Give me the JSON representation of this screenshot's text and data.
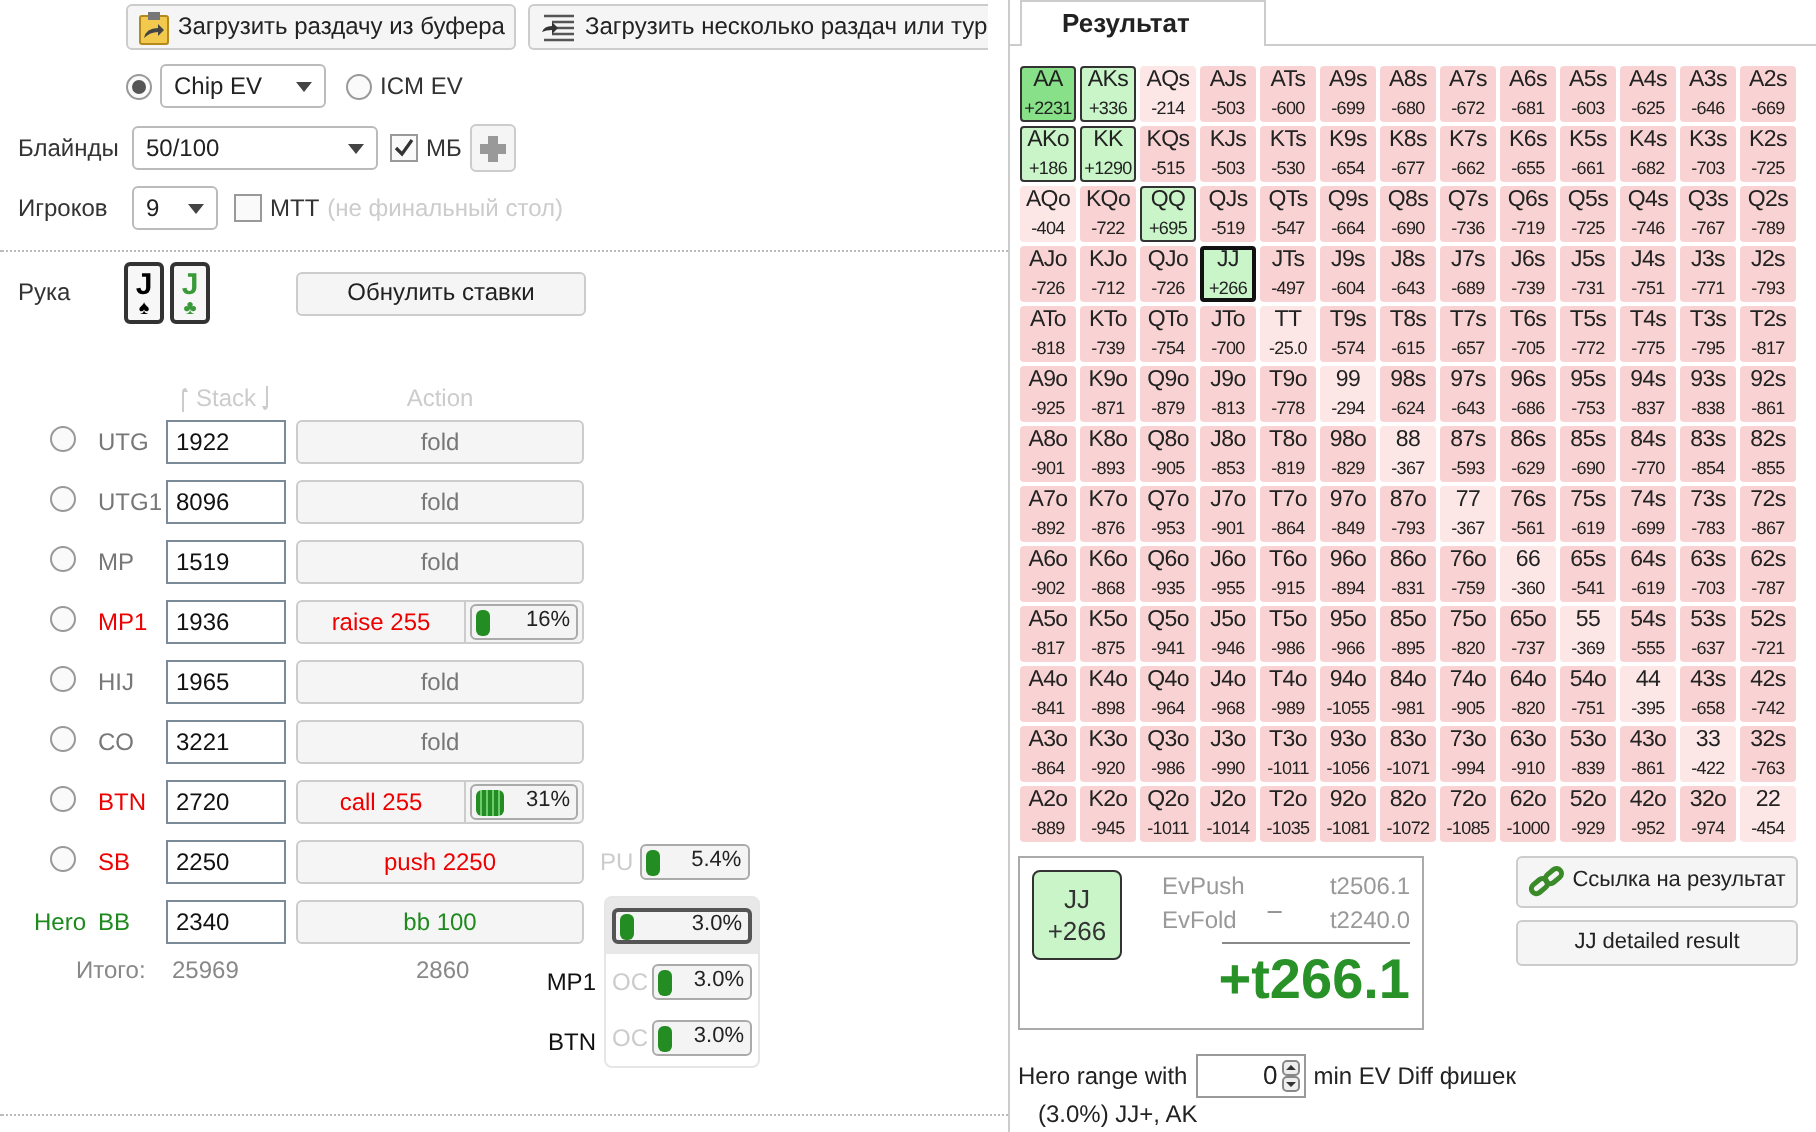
{
  "toolbar": {
    "buttons": [
      {
        "label": "Загрузить раздачу из буфера",
        "kind": "clipboard"
      },
      {
        "label": "Загрузить несколько раздач или тур",
        "kind": "list"
      }
    ]
  },
  "ev_modes": [
    {
      "kind": "select",
      "value": "Chip EV",
      "selected": true
    },
    {
      "kind": "label",
      "label": "ICM EV",
      "selected": false
    }
  ],
  "blinds": {
    "label": "Блайнды",
    "value": "50/100",
    "checkbox": {
      "label": "МБ",
      "checked": true
    }
  },
  "players": {
    "label": "Игроков",
    "value": "9",
    "checkbox": {
      "label": "MTT",
      "checked": false
    },
    "note": "(не финальный стол)"
  },
  "hand": {
    "label": "Рука",
    "cards": [
      {
        "rank": "J",
        "suit": "♠",
        "color": "#000000"
      },
      {
        "rank": "J",
        "suit": "♣",
        "color": "#3a9a3a"
      }
    ],
    "reset_button": "Обнулить ставки"
  },
  "seats": {
    "columns": [
      "Stack",
      "Action"
    ],
    "rows": [
      {
        "position": "UTG",
        "stack": "1922",
        "action": "fold",
        "kind": "fold",
        "selected": false
      },
      {
        "position": "UTG1",
        "stack": "8096",
        "action": "fold",
        "kind": "fold",
        "selected": false
      },
      {
        "position": "MP",
        "stack": "1519",
        "action": "fold",
        "kind": "fold",
        "selected": false
      },
      {
        "position": "MP1",
        "stack": "1936",
        "action": "raise 255",
        "kind": "bet",
        "selected": false,
        "range": {
          "level": 0.16,
          "reading": "16%"
        }
      },
      {
        "position": "HIJ",
        "stack": "1965",
        "action": "fold",
        "kind": "fold",
        "selected": false
      },
      {
        "position": "CO",
        "stack": "3221",
        "action": "fold",
        "kind": "fold",
        "selected": false
      },
      {
        "position": "BTN",
        "stack": "2720",
        "action": "call 255",
        "kind": "bet",
        "selected": false,
        "range": {
          "level": 0.31,
          "reading": "31%"
        }
      },
      {
        "position": "SB",
        "stack": "2250",
        "action": "push 2250",
        "kind": "bet",
        "selected": false,
        "side": {
          "tag": "PU",
          "level": 0.054,
          "reading": "5.4%"
        }
      }
    ],
    "hero": {
      "tag": "Hero",
      "position": "BB",
      "stack": "2340",
      "action": "bb 100"
    },
    "hero_ranges": [
      {
        "reading": "3.0%",
        "level": 0.03,
        "selected": true
      },
      {
        "position": "MP1",
        "tag": "OC",
        "reading": "3.0%",
        "level": 0.03,
        "selected": false
      },
      {
        "position": "BTN",
        "tag": "OC",
        "reading": "3.0%",
        "level": 0.03,
        "selected": false
      }
    ],
    "totals": {
      "label": "Итого:",
      "stack": "25969",
      "action": "2860"
    }
  },
  "tabs": [
    {
      "label": "Результат",
      "selected": true
    }
  ],
  "grid": {
    "rows": [
      {
        "cells": [
          {
            "hand": "AA",
            "ev": "+2231",
            "kind": "top",
            "selected": false
          },
          {
            "hand": "AKs",
            "ev": "+336",
            "kind": "range",
            "selected": false
          },
          {
            "hand": "AQs",
            "ev": "-214",
            "kind": "near",
            "selected": false
          },
          {
            "hand": "AJs",
            "ev": "-503",
            "kind": "neg",
            "selected": false
          },
          {
            "hand": "ATs",
            "ev": "-600",
            "kind": "neg",
            "selected": false
          },
          {
            "hand": "A9s",
            "ev": "-699",
            "kind": "neg",
            "selected": false
          },
          {
            "hand": "A8s",
            "ev": "-680",
            "kind": "neg",
            "selected": false
          },
          {
            "hand": "A7s",
            "ev": "-672",
            "kind": "neg",
            "selected": false
          },
          {
            "hand": "A6s",
            "ev": "-681",
            "kind": "neg",
            "selected": false
          },
          {
            "hand": "A5s",
            "ev": "-603",
            "kind": "neg",
            "selected": false
          },
          {
            "hand": "A4s",
            "ev": "-625",
            "kind": "neg",
            "selected": false
          },
          {
            "hand": "A3s",
            "ev": "-646",
            "kind": "neg",
            "selected": false
          },
          {
            "hand": "A2s",
            "ev": "-669",
            "kind": "neg",
            "selected": false
          }
        ]
      },
      {
        "cells": [
          {
            "hand": "AKo",
            "ev": "+186",
            "kind": "range",
            "selected": false
          },
          {
            "hand": "KK",
            "ev": "+1290",
            "kind": "range",
            "selected": false
          },
          {
            "hand": "KQs",
            "ev": "-515",
            "kind": "neg",
            "selected": false
          },
          {
            "hand": "KJs",
            "ev": "-503",
            "kind": "neg",
            "selected": false
          },
          {
            "hand": "KTs",
            "ev": "-530",
            "kind": "neg",
            "selected": false
          },
          {
            "hand": "K9s",
            "ev": "-654",
            "kind": "neg",
            "selected": false
          },
          {
            "hand": "K8s",
            "ev": "-677",
            "kind": "neg",
            "selected": false
          },
          {
            "hand": "K7s",
            "ev": "-662",
            "kind": "neg",
            "selected": false
          },
          {
            "hand": "K6s",
            "ev": "-655",
            "kind": "neg",
            "selected": false
          },
          {
            "hand": "K5s",
            "ev": "-661",
            "kind": "neg",
            "selected": false
          },
          {
            "hand": "K4s",
            "ev": "-682",
            "kind": "neg",
            "selected": false
          },
          {
            "hand": "K3s",
            "ev": "-703",
            "kind": "neg",
            "selected": false
          },
          {
            "hand": "K2s",
            "ev": "-725",
            "kind": "neg",
            "selected": false
          }
        ]
      },
      {
        "cells": [
          {
            "hand": "AQo",
            "ev": "-404",
            "kind": "near",
            "selected": false
          },
          {
            "hand": "KQo",
            "ev": "-722",
            "kind": "neg",
            "selected": false
          },
          {
            "hand": "QQ",
            "ev": "+695",
            "kind": "range",
            "selected": false
          },
          {
            "hand": "QJs",
            "ev": "-519",
            "kind": "neg",
            "selected": false
          },
          {
            "hand": "QTs",
            "ev": "-547",
            "kind": "neg",
            "selected": false
          },
          {
            "hand": "Q9s",
            "ev": "-664",
            "kind": "neg",
            "selected": false
          },
          {
            "hand": "Q8s",
            "ev": "-690",
            "kind": "neg",
            "selected": false
          },
          {
            "hand": "Q7s",
            "ev": "-736",
            "kind": "neg",
            "selected": false
          },
          {
            "hand": "Q6s",
            "ev": "-719",
            "kind": "neg",
            "selected": false
          },
          {
            "hand": "Q5s",
            "ev": "-725",
            "kind": "neg",
            "selected": false
          },
          {
            "hand": "Q4s",
            "ev": "-746",
            "kind": "neg",
            "selected": false
          },
          {
            "hand": "Q3s",
            "ev": "-767",
            "kind": "neg",
            "selected": false
          },
          {
            "hand": "Q2s",
            "ev": "-789",
            "kind": "neg",
            "selected": false
          }
        ]
      },
      {
        "cells": [
          {
            "hand": "AJo",
            "ev": "-726",
            "kind": "neg",
            "selected": false
          },
          {
            "hand": "KJo",
            "ev": "-712",
            "kind": "neg",
            "selected": false
          },
          {
            "hand": "QJo",
            "ev": "-726",
            "kind": "neg",
            "selected": false
          },
          {
            "hand": "JJ",
            "ev": "+266",
            "kind": "range",
            "selected": true
          },
          {
            "hand": "JTs",
            "ev": "-497",
            "kind": "neg",
            "selected": false
          },
          {
            "hand": "J9s",
            "ev": "-604",
            "kind": "neg",
            "selected": false
          },
          {
            "hand": "J8s",
            "ev": "-643",
            "kind": "neg",
            "selected": false
          },
          {
            "hand": "J7s",
            "ev": "-689",
            "kind": "neg",
            "selected": false
          },
          {
            "hand": "J6s",
            "ev": "-739",
            "kind": "neg",
            "selected": false
          },
          {
            "hand": "J5s",
            "ev": "-731",
            "kind": "neg",
            "selected": false
          },
          {
            "hand": "J4s",
            "ev": "-751",
            "kind": "neg",
            "selected": false
          },
          {
            "hand": "J3s",
            "ev": "-771",
            "kind": "neg",
            "selected": false
          },
          {
            "hand": "J2s",
            "ev": "-793",
            "kind": "neg",
            "selected": false
          }
        ]
      },
      {
        "cells": [
          {
            "hand": "ATo",
            "ev": "-818",
            "kind": "neg",
            "selected": false
          },
          {
            "hand": "KTo",
            "ev": "-739",
            "kind": "neg",
            "selected": false
          },
          {
            "hand": "QTo",
            "ev": "-754",
            "kind": "neg",
            "selected": false
          },
          {
            "hand": "JTo",
            "ev": "-700",
            "kind": "neg",
            "selected": false
          },
          {
            "hand": "TT",
            "ev": "-25.0",
            "kind": "near",
            "selected": false
          },
          {
            "hand": "T9s",
            "ev": "-574",
            "kind": "neg",
            "selected": false
          },
          {
            "hand": "T8s",
            "ev": "-615",
            "kind": "neg",
            "selected": false
          },
          {
            "hand": "T7s",
            "ev": "-657",
            "kind": "neg",
            "selected": false
          },
          {
            "hand": "T6s",
            "ev": "-705",
            "kind": "neg",
            "selected": false
          },
          {
            "hand": "T5s",
            "ev": "-772",
            "kind": "neg",
            "selected": false
          },
          {
            "hand": "T4s",
            "ev": "-775",
            "kind": "neg",
            "selected": false
          },
          {
            "hand": "T3s",
            "ev": "-795",
            "kind": "neg",
            "selected": false
          },
          {
            "hand": "T2s",
            "ev": "-817",
            "kind": "neg",
            "selected": false
          }
        ]
      },
      {
        "cells": [
          {
            "hand": "A9o",
            "ev": "-925",
            "kind": "neg",
            "selected": false
          },
          {
            "hand": "K9o",
            "ev": "-871",
            "kind": "neg",
            "selected": false
          },
          {
            "hand": "Q9o",
            "ev": "-879",
            "kind": "neg",
            "selected": false
          },
          {
            "hand": "J9o",
            "ev": "-813",
            "kind": "neg",
            "selected": false
          },
          {
            "hand": "T9o",
            "ev": "-778",
            "kind": "neg",
            "selected": false
          },
          {
            "hand": "99",
            "ev": "-294",
            "kind": "near",
            "selected": false
          },
          {
            "hand": "98s",
            "ev": "-624",
            "kind": "neg",
            "selected": false
          },
          {
            "hand": "97s",
            "ev": "-643",
            "kind": "neg",
            "selected": false
          },
          {
            "hand": "96s",
            "ev": "-686",
            "kind": "neg",
            "selected": false
          },
          {
            "hand": "95s",
            "ev": "-753",
            "kind": "neg",
            "selected": false
          },
          {
            "hand": "94s",
            "ev": "-837",
            "kind": "neg",
            "selected": false
          },
          {
            "hand": "93s",
            "ev": "-838",
            "kind": "neg",
            "selected": false
          },
          {
            "hand": "92s",
            "ev": "-861",
            "kind": "neg",
            "selected": false
          }
        ]
      },
      {
        "cells": [
          {
            "hand": "A8o",
            "ev": "-901",
            "kind": "neg",
            "selected": false
          },
          {
            "hand": "K8o",
            "ev": "-893",
            "kind": "neg",
            "selected": false
          },
          {
            "hand": "Q8o",
            "ev": "-905",
            "kind": "neg",
            "selected": false
          },
          {
            "hand": "J8o",
            "ev": "-853",
            "kind": "neg",
            "selected": false
          },
          {
            "hand": "T8o",
            "ev": "-819",
            "kind": "neg",
            "selected": false
          },
          {
            "hand": "98o",
            "ev": "-829",
            "kind": "neg",
            "selected": false
          },
          {
            "hand": "88",
            "ev": "-367",
            "kind": "near",
            "selected": false
          },
          {
            "hand": "87s",
            "ev": "-593",
            "kind": "neg",
            "selected": false
          },
          {
            "hand": "86s",
            "ev": "-629",
            "kind": "neg",
            "selected": false
          },
          {
            "hand": "85s",
            "ev": "-690",
            "kind": "neg",
            "selected": false
          },
          {
            "hand": "84s",
            "ev": "-770",
            "kind": "neg",
            "selected": false
          },
          {
            "hand": "83s",
            "ev": "-854",
            "kind": "neg",
            "selected": false
          },
          {
            "hand": "82s",
            "ev": "-855",
            "kind": "neg",
            "selected": false
          }
        ]
      },
      {
        "cells": [
          {
            "hand": "A7o",
            "ev": "-892",
            "kind": "neg",
            "selected": false
          },
          {
            "hand": "K7o",
            "ev": "-876",
            "kind": "neg",
            "selected": false
          },
          {
            "hand": "Q7o",
            "ev": "-953",
            "kind": "neg",
            "selected": false
          },
          {
            "hand": "J7o",
            "ev": "-901",
            "kind": "neg",
            "selected": false
          },
          {
            "hand": "T7o",
            "ev": "-864",
            "kind": "neg",
            "selected": false
          },
          {
            "hand": "97o",
            "ev": "-849",
            "kind": "neg",
            "selected": false
          },
          {
            "hand": "87o",
            "ev": "-793",
            "kind": "neg",
            "selected": false
          },
          {
            "hand": "77",
            "ev": "-367",
            "kind": "near",
            "selected": false
          },
          {
            "hand": "76s",
            "ev": "-561",
            "kind": "neg",
            "selected": false
          },
          {
            "hand": "75s",
            "ev": "-619",
            "kind": "neg",
            "selected": false
          },
          {
            "hand": "74s",
            "ev": "-699",
            "kind": "neg",
            "selected": false
          },
          {
            "hand": "73s",
            "ev": "-783",
            "kind": "neg",
            "selected": false
          },
          {
            "hand": "72s",
            "ev": "-867",
            "kind": "neg",
            "selected": false
          }
        ]
      },
      {
        "cells": [
          {
            "hand": "A6o",
            "ev": "-902",
            "kind": "neg",
            "selected": false
          },
          {
            "hand": "K6o",
            "ev": "-868",
            "kind": "neg",
            "selected": false
          },
          {
            "hand": "Q6o",
            "ev": "-935",
            "kind": "neg",
            "selected": false
          },
          {
            "hand": "J6o",
            "ev": "-955",
            "kind": "neg",
            "selected": false
          },
          {
            "hand": "T6o",
            "ev": "-915",
            "kind": "neg",
            "selected": false
          },
          {
            "hand": "96o",
            "ev": "-894",
            "kind": "neg",
            "selected": false
          },
          {
            "hand": "86o",
            "ev": "-831",
            "kind": "neg",
            "selected": false
          },
          {
            "hand": "76o",
            "ev": "-759",
            "kind": "neg",
            "selected": false
          },
          {
            "hand": "66",
            "ev": "-360",
            "kind": "near",
            "selected": false
          },
          {
            "hand": "65s",
            "ev": "-541",
            "kind": "neg",
            "selected": false
          },
          {
            "hand": "64s",
            "ev": "-619",
            "kind": "neg",
            "selected": false
          },
          {
            "hand": "63s",
            "ev": "-703",
            "kind": "neg",
            "selected": false
          },
          {
            "hand": "62s",
            "ev": "-787",
            "kind": "neg",
            "selected": false
          }
        ]
      },
      {
        "cells": [
          {
            "hand": "A5o",
            "ev": "-817",
            "kind": "neg",
            "selected": false
          },
          {
            "hand": "K5o",
            "ev": "-875",
            "kind": "neg",
            "selected": false
          },
          {
            "hand": "Q5o",
            "ev": "-941",
            "kind": "neg",
            "selected": false
          },
          {
            "hand": "J5o",
            "ev": "-946",
            "kind": "neg",
            "selected": false
          },
          {
            "hand": "T5o",
            "ev": "-986",
            "kind": "neg",
            "selected": false
          },
          {
            "hand": "95o",
            "ev": "-966",
            "kind": "neg",
            "selected": false
          },
          {
            "hand": "85o",
            "ev": "-895",
            "kind": "neg",
            "selected": false
          },
          {
            "hand": "75o",
            "ev": "-820",
            "kind": "neg",
            "selected": false
          },
          {
            "hand": "65o",
            "ev": "-737",
            "kind": "neg",
            "selected": false
          },
          {
            "hand": "55",
            "ev": "-369",
            "kind": "near",
            "selected": false
          },
          {
            "hand": "54s",
            "ev": "-555",
            "kind": "neg",
            "selected": false
          },
          {
            "hand": "53s",
            "ev": "-637",
            "kind": "neg",
            "selected": false
          },
          {
            "hand": "52s",
            "ev": "-721",
            "kind": "neg",
            "selected": false
          }
        ]
      },
      {
        "cells": [
          {
            "hand": "A4o",
            "ev": "-841",
            "kind": "neg",
            "selected": false
          },
          {
            "hand": "K4o",
            "ev": "-898",
            "kind": "neg",
            "selected": false
          },
          {
            "hand": "Q4o",
            "ev": "-964",
            "kind": "neg",
            "selected": false
          },
          {
            "hand": "J4o",
            "ev": "-968",
            "kind": "neg",
            "selected": false
          },
          {
            "hand": "T4o",
            "ev": "-989",
            "kind": "neg",
            "selected": false
          },
          {
            "hand": "94o",
            "ev": "-1055",
            "kind": "neg",
            "selected": false
          },
          {
            "hand": "84o",
            "ev": "-981",
            "kind": "neg",
            "selected": false
          },
          {
            "hand": "74o",
            "ev": "-905",
            "kind": "neg",
            "selected": false
          },
          {
            "hand": "64o",
            "ev": "-820",
            "kind": "neg",
            "selected": false
          },
          {
            "hand": "54o",
            "ev": "-751",
            "kind": "neg",
            "selected": false
          },
          {
            "hand": "44",
            "ev": "-395",
            "kind": "near",
            "selected": false
          },
          {
            "hand": "43s",
            "ev": "-658",
            "kind": "neg",
            "selected": false
          },
          {
            "hand": "42s",
            "ev": "-742",
            "kind": "neg",
            "selected": false
          }
        ]
      },
      {
        "cells": [
          {
            "hand": "A3o",
            "ev": "-864",
            "kind": "neg",
            "selected": false
          },
          {
            "hand": "K3o",
            "ev": "-920",
            "kind": "neg",
            "selected": false
          },
          {
            "hand": "Q3o",
            "ev": "-986",
            "kind": "neg",
            "selected": false
          },
          {
            "hand": "J3o",
            "ev": "-990",
            "kind": "neg",
            "selected": false
          },
          {
            "hand": "T3o",
            "ev": "-1011",
            "kind": "neg",
            "selected": false
          },
          {
            "hand": "93o",
            "ev": "-1056",
            "kind": "neg",
            "selected": false
          },
          {
            "hand": "83o",
            "ev": "-1071",
            "kind": "neg",
            "selected": false
          },
          {
            "hand": "73o",
            "ev": "-994",
            "kind": "neg",
            "selected": false
          },
          {
            "hand": "63o",
            "ev": "-910",
            "kind": "neg",
            "selected": false
          },
          {
            "hand": "53o",
            "ev": "-839",
            "kind": "neg",
            "selected": false
          },
          {
            "hand": "43o",
            "ev": "-861",
            "kind": "neg",
            "selected": false
          },
          {
            "hand": "33",
            "ev": "-422",
            "kind": "near",
            "selected": false
          },
          {
            "hand": "32s",
            "ev": "-763",
            "kind": "neg",
            "selected": false
          }
        ]
      },
      {
        "cells": [
          {
            "hand": "A2o",
            "ev": "-889",
            "kind": "neg",
            "selected": false
          },
          {
            "hand": "K2o",
            "ev": "-945",
            "kind": "neg",
            "selected": false
          },
          {
            "hand": "Q2o",
            "ev": "-1011",
            "kind": "neg",
            "selected": false
          },
          {
            "hand": "J2o",
            "ev": "-1014",
            "kind": "neg",
            "selected": false
          },
          {
            "hand": "T2o",
            "ev": "-1035",
            "kind": "neg",
            "selected": false
          },
          {
            "hand": "92o",
            "ev": "-1081",
            "kind": "neg",
            "selected": false
          },
          {
            "hand": "82o",
            "ev": "-1072",
            "kind": "neg",
            "selected": false
          },
          {
            "hand": "72o",
            "ev": "-1085",
            "kind": "neg",
            "selected": false
          },
          {
            "hand": "62o",
            "ev": "-1000",
            "kind": "neg",
            "selected": false
          },
          {
            "hand": "52o",
            "ev": "-929",
            "kind": "neg",
            "selected": false
          },
          {
            "hand": "42o",
            "ev": "-952",
            "kind": "neg",
            "selected": false
          },
          {
            "hand": "32o",
            "ev": "-974",
            "kind": "neg",
            "selected": false
          },
          {
            "hand": "22",
            "ev": "-454",
            "kind": "near",
            "selected": false
          }
        ]
      }
    ]
  },
  "summary": {
    "hand": "JJ",
    "ev": "+266",
    "lines": [
      {
        "label": "EvPush",
        "value": "t2506.1"
      },
      {
        "label": "EvFold",
        "value": "t2240.0"
      }
    ],
    "operator": "_",
    "total": "+t266.1"
  },
  "link_button": "Ссылка на результат",
  "detail_button": "JJ detailed result",
  "hero_range": {
    "prefix": "Hero range with",
    "value": "0",
    "suffix": "min EV Diff фишек",
    "result": "(3.0%) JJ+, AK"
  }
}
